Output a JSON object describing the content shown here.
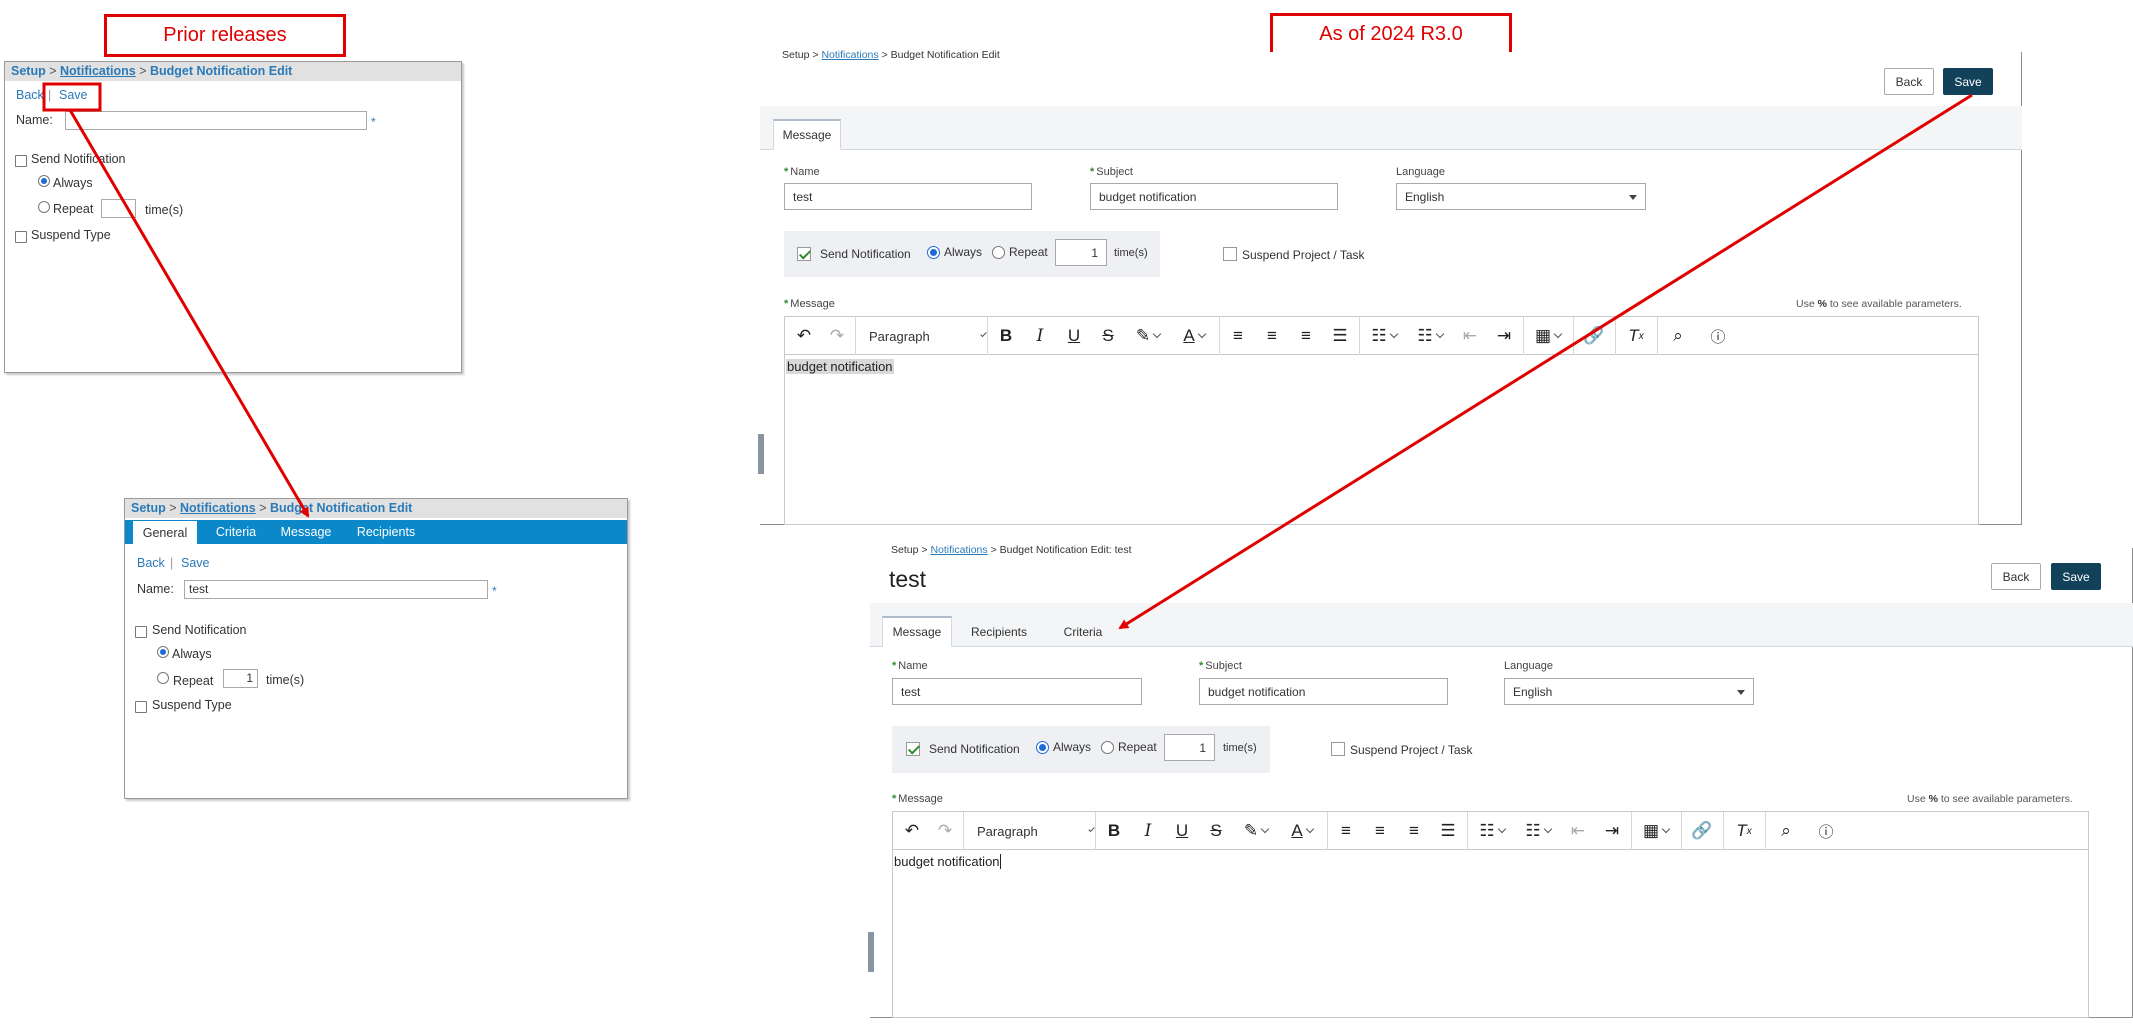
{
  "callouts": {
    "prior": "Prior releases",
    "asof": "As of 2024 R3.0"
  },
  "old1": {
    "crumb": {
      "setup": "Setup",
      "sep": ">",
      "notifications": "Notifications",
      "page": "Budget Notification Edit"
    },
    "back": "Back",
    "divider": "|",
    "save": "Save",
    "name_label": "Name:",
    "name_value": "",
    "star": "*",
    "send_notification": "Send Notification",
    "always": "Always",
    "repeat": "Repeat",
    "repeat_value": "",
    "times": "time(s)",
    "suspend_type": "Suspend Type"
  },
  "old2": {
    "crumb": {
      "setup": "Setup",
      "sep": ">",
      "notifications": "Notifications",
      "page": "Budget Notification Edit"
    },
    "tabs": [
      "General",
      "Criteria",
      "Message",
      "Recipients"
    ],
    "back": "Back",
    "divider": "|",
    "save": "Save",
    "name_label": "Name:",
    "name_value": "test",
    "star": "*",
    "send_notification": "Send Notification",
    "always": "Always",
    "repeat": "Repeat",
    "repeat_value": "1",
    "times": "time(s)",
    "suspend_type": "Suspend Type"
  },
  "new1": {
    "crumb": {
      "setup": "Setup",
      "sep": ">",
      "notifications": "Notifications",
      "page": "Budget Notification Edit"
    },
    "back": "Back",
    "save": "Save",
    "tabs": [
      "Message"
    ],
    "name_label": "Name",
    "name_value": "test",
    "subject_label": "Subject",
    "subject_value": "budget notification",
    "language_label": "Language",
    "language_value": "English",
    "send_notification": "Send Notification",
    "always": "Always",
    "repeat": "Repeat",
    "repeat_value": "1",
    "times": "time(s)",
    "suspend": "Suspend Project / Task",
    "message_label": "Message",
    "hint_pre": "Use ",
    "hint_key": "%",
    "hint_post": " to see available parameters.",
    "paragraph": "Paragraph",
    "content": "budget notification"
  },
  "new2": {
    "crumb": {
      "setup": "Setup",
      "sep": ">",
      "notifications": "Notifications",
      "page": "Budget Notification Edit: test"
    },
    "title": "test",
    "back": "Back",
    "save": "Save",
    "tabs": [
      "Message",
      "Recipients",
      "Criteria"
    ],
    "name_label": "Name",
    "name_value": "test",
    "subject_label": "Subject",
    "subject_value": "budget notification",
    "language_label": "Language",
    "language_value": "English",
    "send_notification": "Send Notification",
    "always": "Always",
    "repeat": "Repeat",
    "repeat_value": "1",
    "times": "time(s)",
    "suspend": "Suspend Project / Task",
    "message_label": "Message",
    "hint_pre": "Use ",
    "hint_key": "%",
    "hint_post": " to see available parameters.",
    "paragraph": "Paragraph",
    "content": "budget notification"
  },
  "colors": {
    "annotation_red": "#e00000",
    "save_button": "#12415a",
    "old_tab_blue": "#0a88c9",
    "link_blue": "#2b7ab8"
  }
}
